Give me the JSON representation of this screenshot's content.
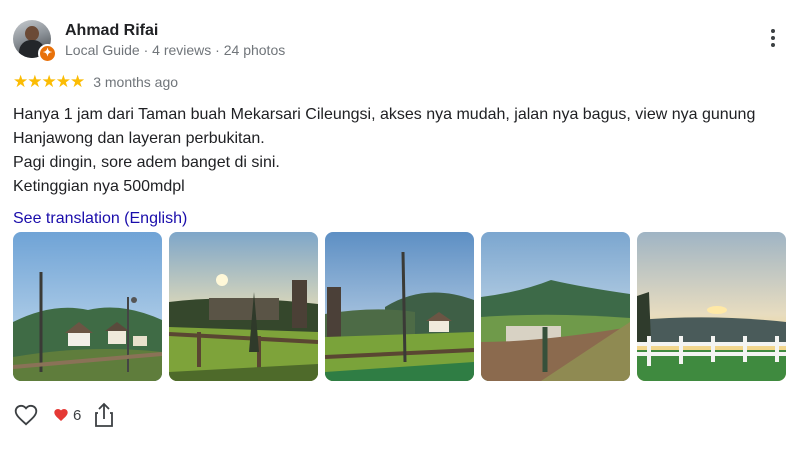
{
  "reviewer": {
    "name": "Ahmad Rifai",
    "meta": "Local Guide · 4 reviews · 24 photos"
  },
  "rating": {
    "stars": 5,
    "stars_text": "★★★★★",
    "date": "3 months ago"
  },
  "review": {
    "text": "Hanya 1 jam dari Taman buah Mekarsari Cileungsi, akses nya mudah, jalan nya bagus, view nya gunung Hanjawong dan layeran perbukitan.\nPagi dingin, sore adem banget di sini.\nKetinggian nya 500mdpl",
    "see_translation": "See translation (English)"
  },
  "photos": [
    {
      "subject": "mountain-village-sunset"
    },
    {
      "subject": "sunset-fence-tower"
    },
    {
      "subject": "tower-mountain-view"
    },
    {
      "subject": "mountain-green-slope"
    },
    {
      "subject": "white-fence-sunset"
    }
  ],
  "reactions": {
    "heart_count": "6"
  },
  "icons": {
    "like": "heart-outline-icon",
    "reaction": "red-heart-icon",
    "share": "share-icon",
    "more": "more-vert-icon"
  },
  "colors": {
    "star": "#fbbc04",
    "link": "#1a0dab",
    "heart": "#e53935",
    "guide_badge": "#e8710a"
  }
}
